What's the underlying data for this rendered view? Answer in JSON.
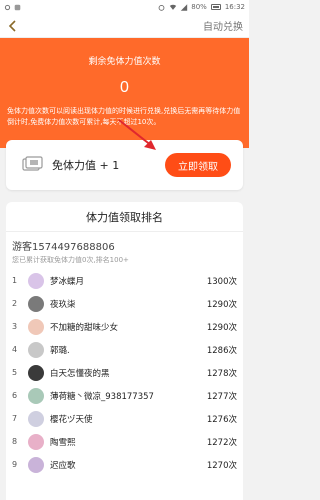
{
  "status_bar": {
    "battery": "80%",
    "time": "16:32"
  },
  "top_bar": {
    "action_label": "自动兑换"
  },
  "header": {
    "title": "剩余免体力值次数",
    "count": "0",
    "description": "免体力值次数可以阅读出现体力值的时候进行兑换,兑换后无需再等待体力值倒计时,免费体力值次数可累计,每天不超过10次。"
  },
  "reward": {
    "label": "免体力值 + 1",
    "button": "立即领取"
  },
  "ranking": {
    "title": "体力值领取排名",
    "me": {
      "name": "游客1574497688806",
      "info": "您已累计获取免体力值0次,排名100+"
    },
    "rows": [
      {
        "rank": "1",
        "name": "梦冰蝶月",
        "score": "1300次",
        "color": "#d9c4e8"
      },
      {
        "rank": "2",
        "name": "夜玖柒",
        "score": "1290次",
        "color": "#7a7a7a"
      },
      {
        "rank": "3",
        "name": "不加糖的甜味少女",
        "score": "1290次",
        "color": "#f0c8b8"
      },
      {
        "rank": "4",
        "name": "郭璐.",
        "score": "1286次",
        "color": "#c8c8c8"
      },
      {
        "rank": "5",
        "name": "白天怎懂夜的黑",
        "score": "1278次",
        "color": "#3a3a3a"
      },
      {
        "rank": "6",
        "name": "薄荷糖丶微凉_938177357",
        "score": "1277次",
        "color": "#a9c9b8"
      },
      {
        "rank": "7",
        "name": "樱花ヅ天使",
        "score": "1276次",
        "color": "#cfcfe0"
      },
      {
        "rank": "8",
        "name": "陶雪熙",
        "score": "1272次",
        "color": "#e8b0c8"
      },
      {
        "rank": "9",
        "name": "迟应歌",
        "score": "1270次",
        "color": "#c9b3d9"
      }
    ]
  }
}
